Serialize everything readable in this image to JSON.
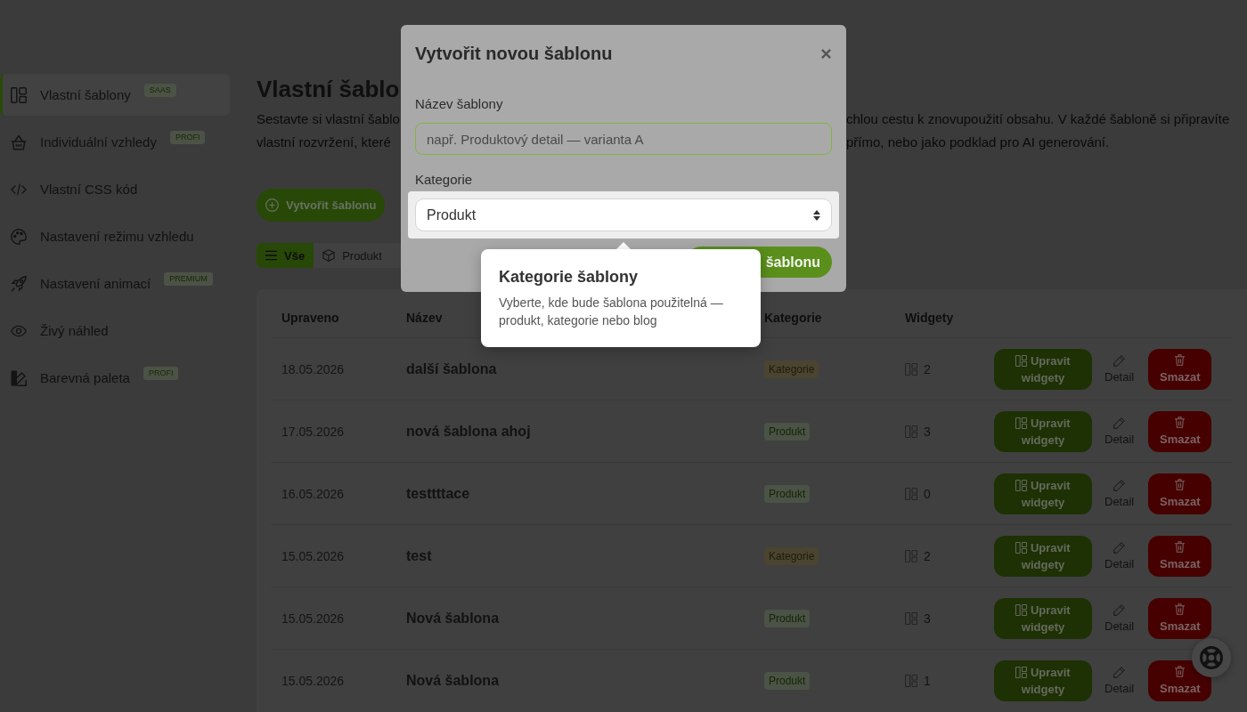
{
  "sidebar": {
    "items": [
      {
        "label": "Vlastní šablony",
        "badge": "SAAS",
        "selected": true
      },
      {
        "label": "Individuální vzhledy",
        "badge": "PROFI",
        "selected": false
      },
      {
        "label": "Vlastní CSS kód",
        "selected": false
      },
      {
        "label": "Nastavení režimu vzhledu",
        "selected": false
      },
      {
        "label": "Nastavení animací",
        "badge": "PREMIUM",
        "selected": false
      },
      {
        "label": "Živý náhled",
        "selected": false
      },
      {
        "label": "Barevná paleta",
        "badge": "PROFI",
        "selected": false
      }
    ]
  },
  "page": {
    "title": "Vlastní šablo",
    "description_left": [
      "Sestavte si vlastní šablo",
      "vlastní rozvržení, které"
    ],
    "description_right": [
      "chlou cestu k znovupoužití obsahu. V každé šabloně si připravíte",
      "přímo, nebo jako podklad pro AI generování."
    ],
    "create_button": "Vytvořit šablonu"
  },
  "filters": [
    {
      "label": "Vše",
      "selected": true
    },
    {
      "label": "Produkt",
      "selected": false
    }
  ],
  "table": {
    "columns": [
      "Upraveno",
      "Název",
      "Kategorie",
      "Widgety"
    ],
    "rows": [
      {
        "updated": "18.05.2026",
        "name": "další šablona",
        "category": {
          "label": "Kategorie",
          "kind": "category"
        },
        "widgets": "2",
        "actions": {
          "edit": "Upravit widgety",
          "detail": "Detail",
          "delete": "Smazat"
        }
      },
      {
        "updated": "17.05.2026",
        "name": "nová šablona ahoj",
        "category": {
          "label": "Produkt",
          "kind": "product"
        },
        "widgets": "3",
        "actions": {
          "edit": "Upravit widgety",
          "detail": "Detail",
          "delete": "Smazat"
        }
      },
      {
        "updated": "16.05.2026",
        "name": "testtttace",
        "category": {
          "label": "Produkt",
          "kind": "product"
        },
        "widgets": "0",
        "actions": {
          "edit": "Upravit widgety",
          "detail": "Detail",
          "delete": "Smazat"
        }
      },
      {
        "updated": "15.05.2026",
        "name": "test",
        "category": {
          "label": "Kategorie",
          "kind": "category"
        },
        "widgets": "2",
        "actions": {
          "edit": "Upravit widgety",
          "detail": "Detail",
          "delete": "Smazat"
        }
      },
      {
        "updated": "15.05.2026",
        "name": "Nová šablona",
        "category": {
          "label": "Produkt",
          "kind": "product"
        },
        "widgets": "3",
        "actions": {
          "edit": "Upravit widgety",
          "detail": "Detail",
          "delete": "Smazat"
        }
      },
      {
        "updated": "15.05.2026",
        "name": "Nová šablona",
        "category": {
          "label": "Produkt",
          "kind": "product"
        },
        "widgets": "1",
        "actions": {
          "edit": "Upravit widgety",
          "detail": "Detail",
          "delete": "Smazat"
        }
      }
    ]
  },
  "modal": {
    "title": "Vytvořit novou šablonu",
    "fields": [
      {
        "kind": "text",
        "label": "Název šablony",
        "placeholder": "např. Produktový detail — varianta A",
        "focused": true,
        "highlighted": false
      },
      {
        "kind": "select",
        "label": "Kategorie",
        "value": "Produkt",
        "focused": false,
        "highlighted": true
      }
    ],
    "submit_button": "šablonu"
  },
  "tour_tooltip": {
    "title": "Kategorie šablony",
    "text": "Vyberte, kde bude šablona použitelná — produkt, kategorie nebo blog"
  }
}
